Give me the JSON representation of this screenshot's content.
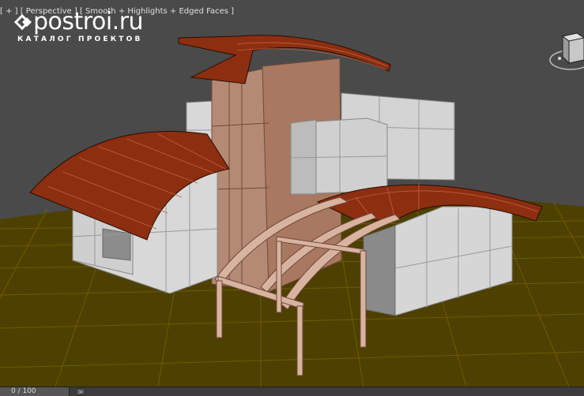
{
  "viewport": {
    "label": "[ + ] [ Perspective ] [ Smooth + Highlights + Edged Faces ]",
    "colors": {
      "background": "#4a4a4a",
      "grid": "#4d4000",
      "roof": "#8c2f10",
      "walls": "#d6d6d6",
      "tower": "#a87860"
    }
  },
  "watermark": {
    "site": "postroi.ru",
    "subtitle": "КАТАЛОГ ПРОЕКТОВ",
    "icon": "diamond-logo-icon"
  },
  "viewcube": {
    "icon": "viewcube-icon"
  },
  "timeline": {
    "frame_counter": "0 / 100",
    "next_icon": "next-frame-arrow-icon",
    "next_glyph": ">"
  }
}
